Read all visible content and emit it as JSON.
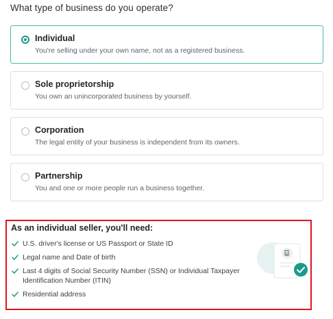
{
  "question": "What type of business do you operate?",
  "options": [
    {
      "title": "Individual",
      "description": "You're selling under your own name, not as a registered business.",
      "selected": true
    },
    {
      "title": "Sole proprietorship",
      "description": "You own an unincorporated business by yourself.",
      "selected": false
    },
    {
      "title": "Corporation",
      "description": "The legal entity of your business is independent from its owners.",
      "selected": false
    },
    {
      "title": "Partnership",
      "description": "You and one or more people run a business together.",
      "selected": false
    }
  ],
  "requirements": {
    "title": "As an individual seller, you'll need:",
    "items": [
      "U.S. driver's license or US Passport or State ID",
      "Legal name and Date of birth",
      "Last 4 digits of Social Security Number (SSN) or Individual Taxpayer Identification Number (ITIN)",
      "Residential address"
    ]
  },
  "icons": {
    "check": "check-icon",
    "document": "document-illustration-icon",
    "verified": "verified-check-icon"
  },
  "colors": {
    "accent": "#1b9a8a",
    "selected_border": "#4bb7a9",
    "highlight_border": "#e0141e"
  }
}
